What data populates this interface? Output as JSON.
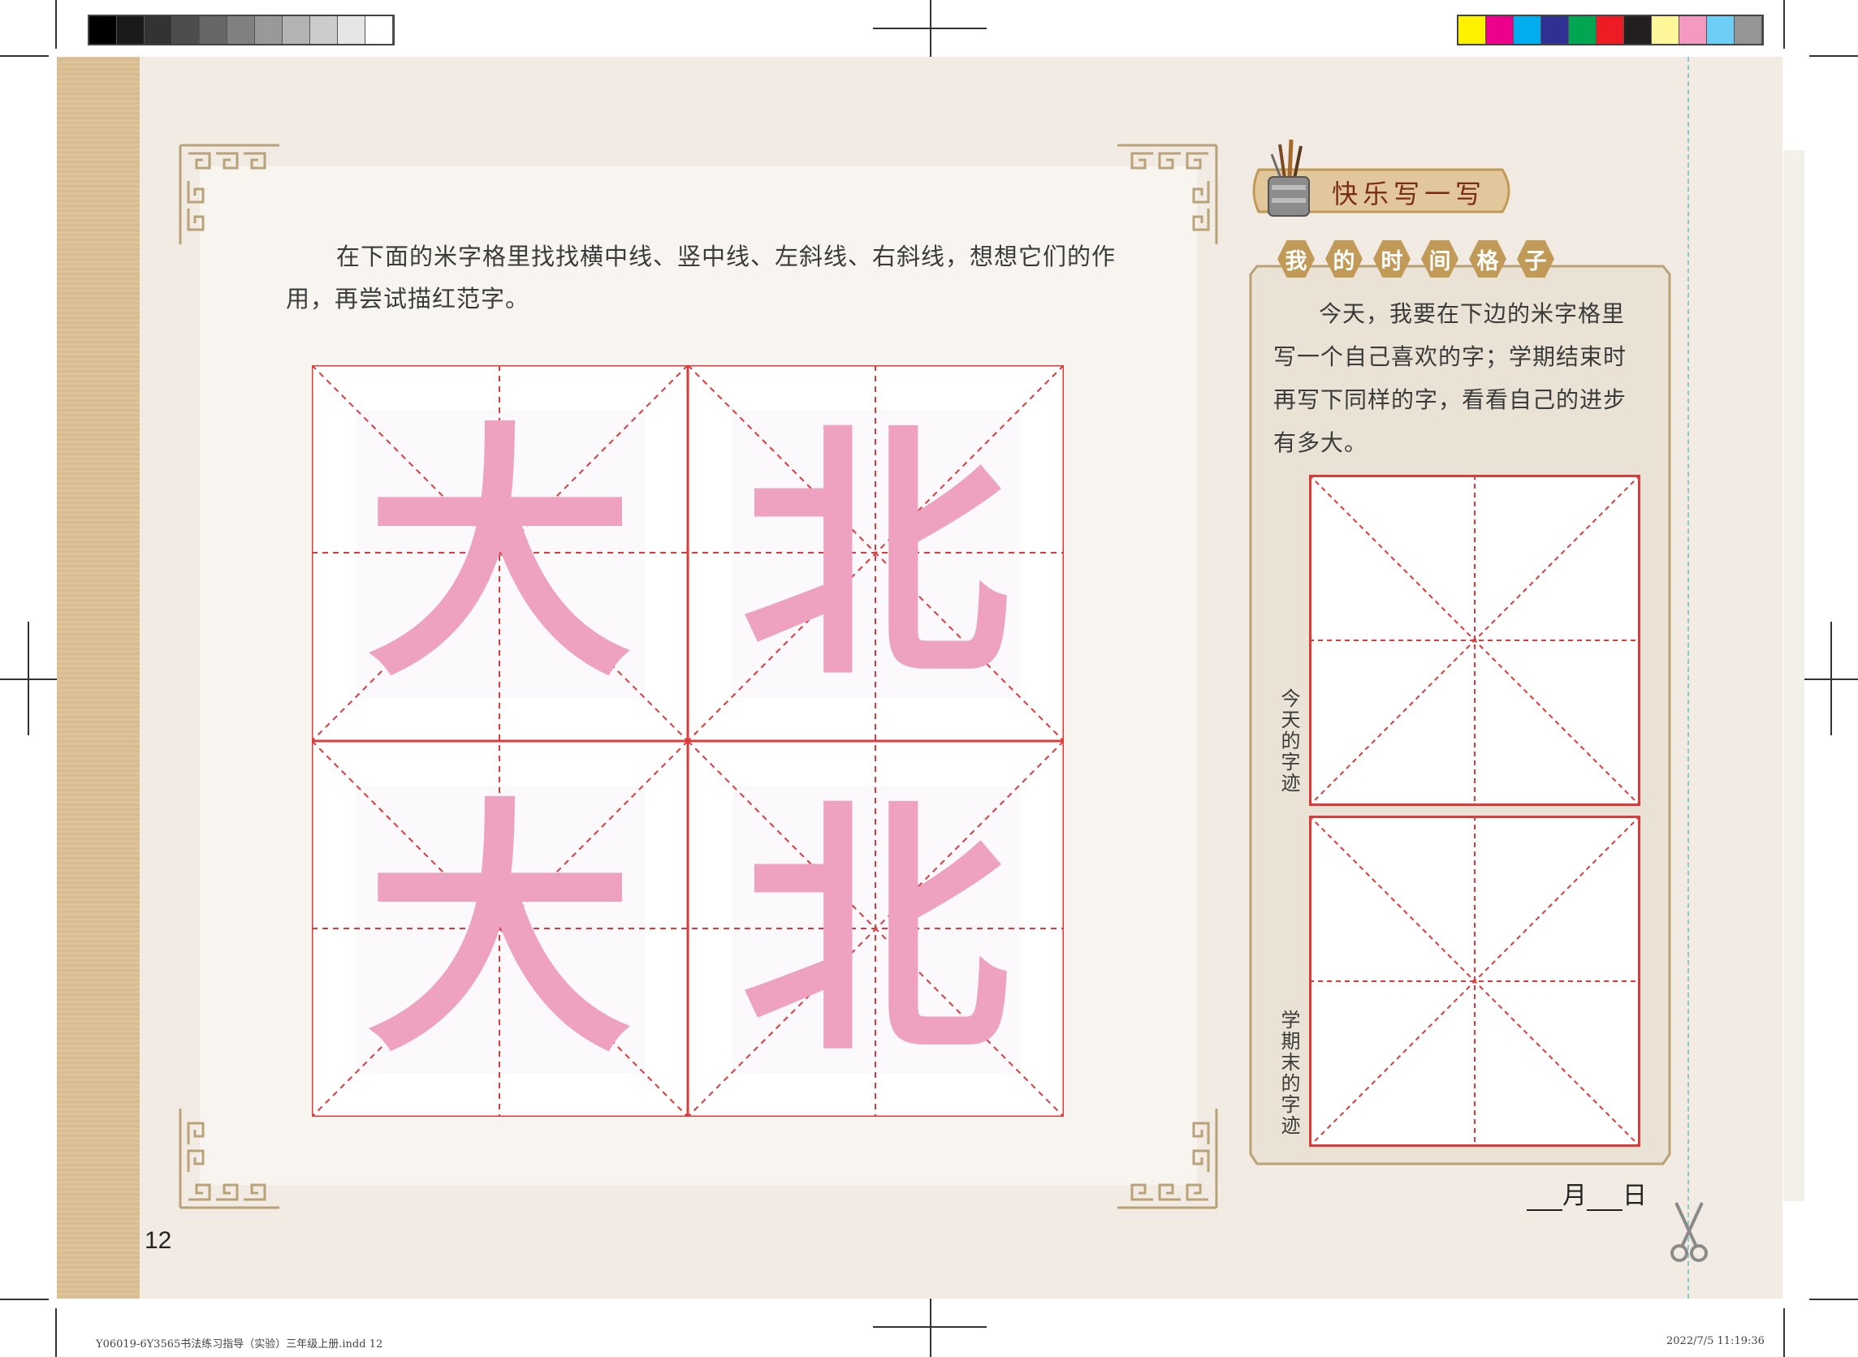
{
  "instruction": {
    "line1": "在下面的米字格里找找横中线、竖中线、左斜线、右斜线，想想它们的作",
    "line2": "用，再尝试描红范字。"
  },
  "practice_characters": [
    "大",
    "北",
    "大",
    "北"
  ],
  "colors": {
    "grid_red": "#de3a3a",
    "trace_pink": "#eea2bf",
    "banner_gold": "#c29a57",
    "page_bg": "#f1ebe3"
  },
  "side": {
    "title": "快乐写一写",
    "subtitle_chars": [
      "我",
      "的",
      "时",
      "间",
      "格",
      "子"
    ],
    "text": {
      "line1": "今天，我要在下边的米字格里",
      "line2": "写一个自己喜欢的字；学期结束时",
      "line3": "再写下同样的字，看看自己的进步",
      "line4": "有多大。"
    },
    "label_today": "今天的字迹",
    "label_term_end": "学期末的字迹",
    "date_month": "月",
    "date_day": "日"
  },
  "page_number": "12",
  "footer": {
    "left": "Y06019-6Y3565书法练习指导（实验）三年级上册.indd   12",
    "right": "2022/7/5   11:19:36"
  },
  "color_bar_gray": [
    "#000000",
    "#1a1a1a",
    "#333333",
    "#4d4d4d",
    "#666666",
    "#808080",
    "#999999",
    "#b3b3b3",
    "#cccccc",
    "#e6e6e6",
    "#ffffff"
  ],
  "color_bar_color": [
    "#fff200",
    "#ec008c",
    "#00aeef",
    "#2e3192",
    "#00a651",
    "#ed1c24",
    "#231f20",
    "#fff799",
    "#f49ac1",
    "#6dcff6",
    "#959595"
  ]
}
